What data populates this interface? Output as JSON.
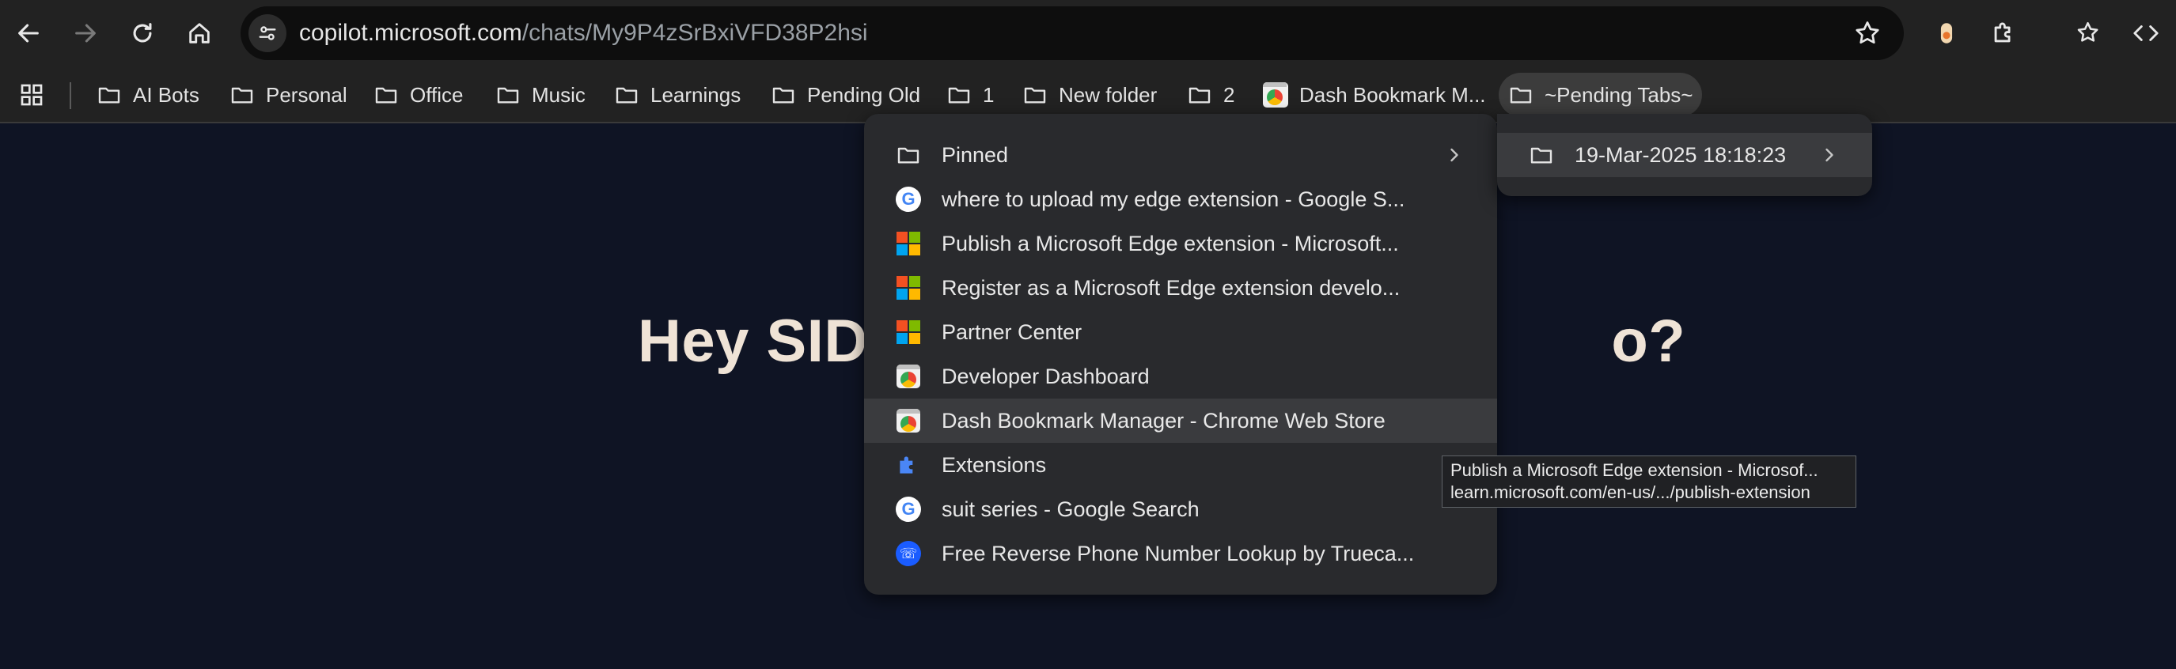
{
  "toolbar": {
    "url_host": "copilot.microsoft.com",
    "url_path": "/chats/My9P4zSrBxiVFD38P2hsi"
  },
  "bookmarks_bar": [
    {
      "label": "AI Bots",
      "icon": "folder-icon"
    },
    {
      "label": "Personal",
      "icon": "folder-icon"
    },
    {
      "label": "Office",
      "icon": "folder-icon"
    },
    {
      "label": "Music",
      "icon": "folder-icon"
    },
    {
      "label": "Learnings",
      "icon": "folder-icon"
    },
    {
      "label": "Pending Old",
      "icon": "folder-icon"
    },
    {
      "label": "1",
      "icon": "folder-icon"
    },
    {
      "label": "New folder",
      "icon": "folder-icon"
    },
    {
      "label": "2",
      "icon": "folder-icon"
    },
    {
      "label": "Dash Bookmark M...",
      "icon": "chrome-web-store-icon"
    },
    {
      "label": "~Pending Tabs~",
      "icon": "folder-icon"
    }
  ],
  "page": {
    "greeting_left": "Hey SIDI",
    "greeting_right": "o?"
  },
  "menu": {
    "items": [
      {
        "label": "Pinned",
        "icon": "folder-icon"
      },
      {
        "label": "where to upload my edge extension - Google S...",
        "icon": "google-icon"
      },
      {
        "label": "Publish a Microsoft Edge extension - Microsoft...",
        "icon": "microsoft-icon"
      },
      {
        "label": "Register as a Microsoft Edge extension develo...",
        "icon": "microsoft-icon"
      },
      {
        "label": "Partner Center",
        "icon": "microsoft-icon"
      },
      {
        "label": "Developer Dashboard",
        "icon": "chrome-web-store-icon"
      },
      {
        "label": "Dash Bookmark Manager - Chrome Web Store",
        "icon": "chrome-web-store-icon"
      },
      {
        "label": "Extensions",
        "icon": "puzzle-icon"
      },
      {
        "label": "suit series - Google Search",
        "icon": "google-icon"
      },
      {
        "label": "Free Reverse Phone Number Lookup by Trueca...",
        "icon": "truecaller-icon"
      }
    ]
  },
  "submenu": {
    "item_label": "19-Mar-2025 18:18:23"
  },
  "tooltip": {
    "title": "Publish a Microsoft Edge extension - Microsof...",
    "url": "learn.microsoft.com/en-us/.../publish-extension"
  },
  "colors": {
    "toolbar_bg": "#222222",
    "page_bg": "#0f1424",
    "menu_bg": "#292a2d",
    "hero_text": "#efe3d6"
  }
}
